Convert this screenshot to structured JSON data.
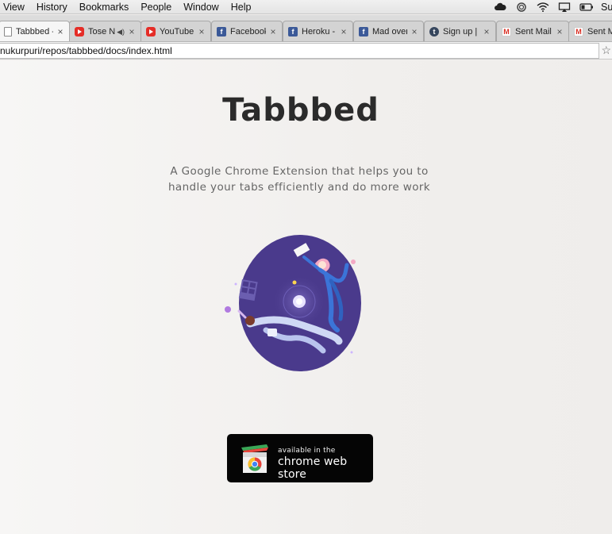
{
  "menubar": {
    "items": [
      "View",
      "History",
      "Bookmarks",
      "People",
      "Window",
      "Help"
    ],
    "user_label": "Su"
  },
  "tabs": [
    {
      "title": "Tabbbed - M",
      "favicon": "doc-icon",
      "active": true
    },
    {
      "title": "Tose Nain",
      "favicon": "youtube-icon",
      "audio": true
    },
    {
      "title": "YouTube",
      "favicon": "youtube-icon"
    },
    {
      "title": "Facebook",
      "favicon": "facebook-icon"
    },
    {
      "title": "Heroku - Ho",
      "favicon": "facebook-icon"
    },
    {
      "title": "Mad over M",
      "favicon": "facebook-icon"
    },
    {
      "title": "Sign up | Tu",
      "favicon": "tumblr-icon"
    },
    {
      "title": "Sent Mail - a",
      "favicon": "gmail-icon"
    },
    {
      "title": "Sent Mail",
      "favicon": "gmail-icon"
    }
  ],
  "addressbar": {
    "url": "nukurpuri/repos/tabbbed/docs/index.html"
  },
  "page": {
    "title": "Tabbbed",
    "tagline_line1": "A Google Chrome Extension that helps you to",
    "tagline_line2": "handle your tabs efficiently and do more work",
    "store_badge": {
      "small": "available in the",
      "big": "chrome web store"
    }
  },
  "colors": {
    "illustration_circle": "#4a3a8c",
    "badge_bg": "#050505",
    "title": "#2b2b2b"
  }
}
